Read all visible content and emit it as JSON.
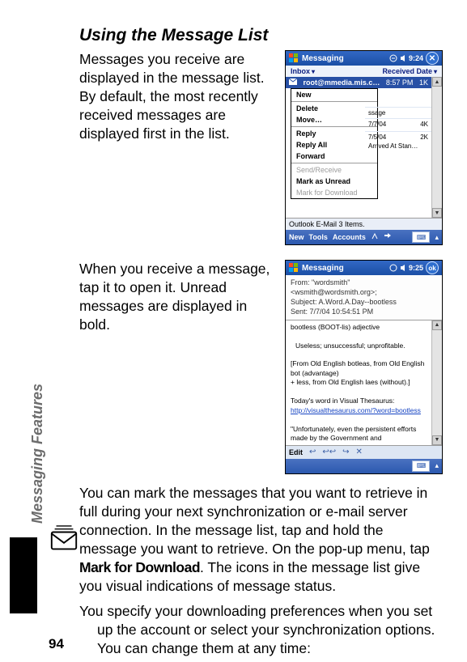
{
  "heading": "Using the Message List",
  "para1": "Messages you receive are displayed in the message list. By default, the most recently received messages are displayed first in the list.",
  "para2": "When you receive a message, tap it to open it. Unread messages are displayed in bold.",
  "para3_a": "You can mark the messages that you want to retrieve in full during your next synchronization or e-mail server connection. In the message list, tap and hold the message you want to retrieve. On the pop-up menu, tap ",
  "para3_b": "Mark for Download",
  "para3_c": ". The icons in the message list give you visual indications of message status.",
  "para4": "You specify your downloading preferences when you set up the account or select your synchronization options. You can change them at any time:",
  "side_label": "Messaging Features",
  "page_number": "94",
  "dev1": {
    "title": "Messaging",
    "clock": "9:24",
    "hdr_left": "Inbox",
    "hdr_right": "Received Date",
    "selrow_addr": "root@mmedia.mis.c…",
    "selrow_time": "8:57 PM",
    "selrow_size": "1K",
    "peek0_label": "ssage",
    "peek1_date": "7/7/04",
    "peek1_size": "4K",
    "peek2_date": "7/5/04",
    "peek2_size": "2K",
    "peek2_sub": "Arrived At Stan…",
    "menu": {
      "new": "New",
      "delete": "Delete",
      "move": "Move…",
      "reply": "Reply",
      "replyall": "Reply All",
      "forward": "Forward",
      "sendrecv": "Send/Receive",
      "markunread": "Mark as Unread",
      "markdl": "Mark for Download"
    },
    "status": "Outlook E-Mail  3 Items.",
    "bb_new": "New",
    "bb_tools": "Tools",
    "bb_accounts": "Accounts"
  },
  "dev2": {
    "title": "Messaging",
    "clock": "9:25",
    "ok": "ok",
    "hdr_from_label": "From:",
    "hdr_from_val": "\"wordsmith\" <wsmith@wordsmith.org>;",
    "hdr_subject_label": "Subject:",
    "hdr_subject_val": "A.Word.A.Day--bootless",
    "hdr_sent_label": "Sent:",
    "hdr_sent_val": "7/7/04 10:54:51 PM",
    "body_line1": "bootless (BOOT-lis) adjective",
    "body_line2": "Useless; unsuccessful; unprofitable.",
    "body_line3": "[From Old English botleas, from Old English bot (advantage)",
    "body_line4": "+ less, from Old English laes (without).]",
    "body_line5": "Today's word in Visual Thesaurus:",
    "body_link": "http://visualthesaurus.com/?word=bootless",
    "body_line6": "\"Unfortunately, even the persistent efforts made by the Government and",
    "edit": "Edit"
  }
}
